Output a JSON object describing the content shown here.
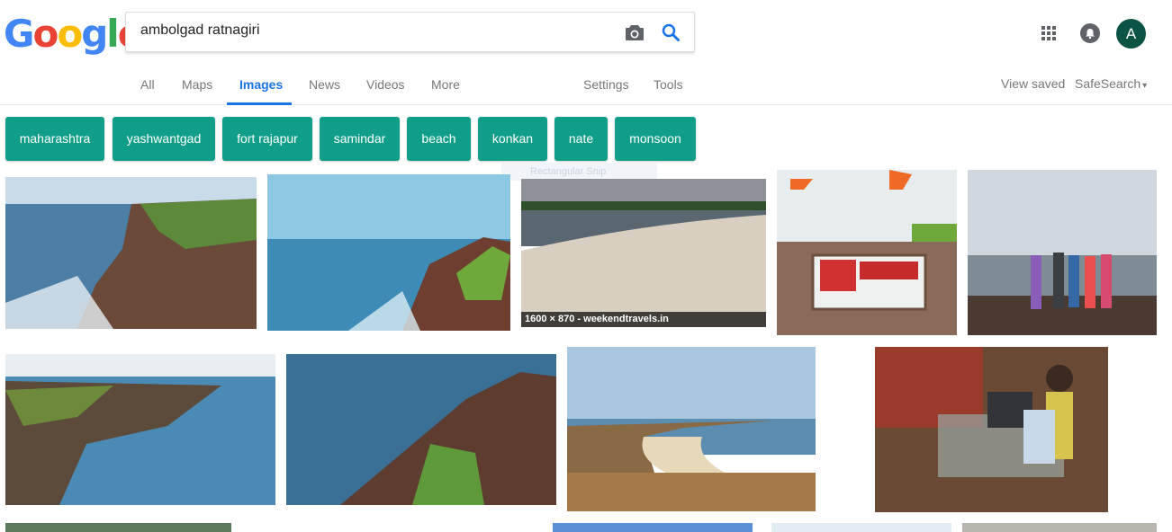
{
  "logo": {
    "text": "Google",
    "letters": [
      "G",
      "o",
      "o",
      "g",
      "l",
      "e"
    ]
  },
  "search": {
    "query": "ambolgad ratnagiri",
    "placeholder": ""
  },
  "nav": {
    "tabs": [
      "All",
      "Maps",
      "Images",
      "News",
      "Videos",
      "More"
    ],
    "active": "Images",
    "settings": "Settings",
    "tools": "Tools"
  },
  "header_right": {
    "view_saved": "View saved",
    "safesearch": "SafeSearch",
    "safesearch_caret": "▾",
    "avatar_letter": "A"
  },
  "chips": [
    "maharashtra",
    "yashwantgad",
    "fort rajapur",
    "samindar",
    "beach",
    "konkan",
    "nate",
    "monsoon"
  ],
  "snip_overlay": "Rectangular Snip",
  "results": {
    "third_caption": "1600 × 870 - weekendtravels.in"
  },
  "colors": {
    "accent": "#1a73e8",
    "chip": "#119e89",
    "avatar": "#0b5345"
  }
}
